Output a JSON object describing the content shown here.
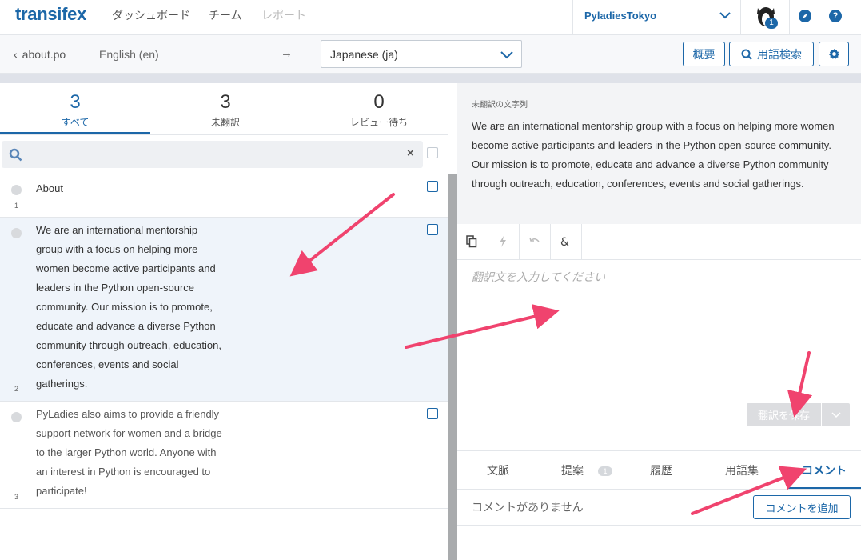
{
  "topnav": {
    "logo": "transifex",
    "links": [
      "ダッシュボード",
      "チーム",
      "レポート"
    ],
    "org_name": "PyladiesTokyo",
    "notification_count": "1",
    "compass_icon": "compass-icon",
    "help_icon": "?"
  },
  "toolbar": {
    "back_label": "about.po",
    "source_language": "English (en)",
    "arrow": "→",
    "target_language": "Japanese (ja)",
    "overview_label": "概要",
    "glossary_search_label": "用語検索"
  },
  "stats": [
    {
      "count": "3",
      "label": "すべて"
    },
    {
      "count": "3",
      "label": "未翻訳"
    },
    {
      "count": "0",
      "label": "レビュー待ち"
    }
  ],
  "search": {
    "placeholder": "",
    "clear": "×"
  },
  "strings": [
    {
      "number": "1",
      "text": "About"
    },
    {
      "number": "2",
      "text": "We are an international mentorship group with a focus on helping more women become active participants and leaders in the Python open-source community. Our mission is to promote, educate and advance a diverse Python community through outreach, education, conferences, events and social gatherings."
    },
    {
      "number": "3",
      "text": "PyLadies also aims to provide a friendly support network for women and a bridge to the larger Python world. Anyone with an interest in Python is encouraged to participate!"
    }
  ],
  "editor": {
    "source_label": "未翻訳の文字列",
    "source_text": "We are an international mentorship group with a focus on helping more women become active participants and leaders in the Python open-source community. Our mission is to promote, educate and advance a diverse Python community through outreach, education, conferences, events and social gatherings.",
    "placeholder": "翻訳文を入力してください",
    "save_label": "翻訳を保存"
  },
  "tabs": [
    {
      "label": "文脈"
    },
    {
      "label": "提案",
      "count": "1"
    },
    {
      "label": "履歴"
    },
    {
      "label": "用語集"
    },
    {
      "label": "コメント"
    }
  ],
  "comments": {
    "empty": "コメントがありません",
    "add_label": "コメントを追加"
  },
  "colors": {
    "accent": "#1c67a8",
    "arrow": "#f0436e",
    "selected_row": "#eff4fa"
  }
}
